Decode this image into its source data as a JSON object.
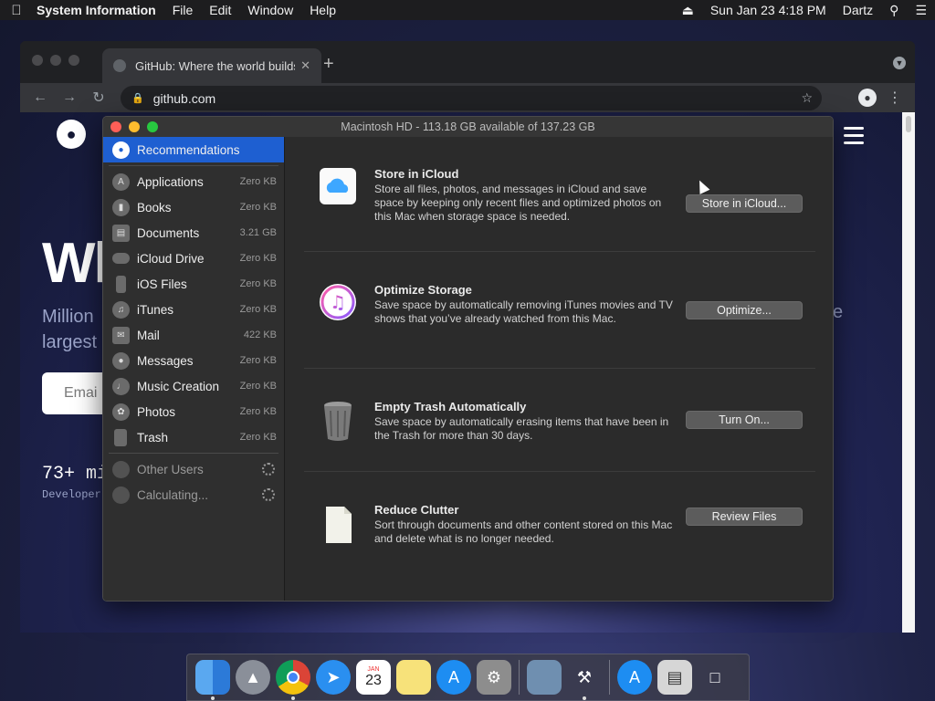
{
  "menubar": {
    "app_name": "System Information",
    "menus": [
      "File",
      "Edit",
      "Window",
      "Help"
    ],
    "clock": "Sun Jan 23  4:18 PM",
    "user": "Dartz"
  },
  "browser": {
    "tab_title": "GitHub: Where the world builds software",
    "url": "github.com",
    "page": {
      "hero": "Wh",
      "subtitle_line1": "Million",
      "subtitle_line2": "largest",
      "email_placeholder": "Emai",
      "stat_value": "73+ mi",
      "stat_label": "Developer",
      "edge_text_m": "m",
      "edge_text_e": "e"
    }
  },
  "sysinfo": {
    "title": "Macintosh HD - 113.18 GB available of 137.23 GB",
    "sidebar": {
      "selected": "Recommendations",
      "items": [
        {
          "label": "Applications",
          "size": "Zero KB"
        },
        {
          "label": "Books",
          "size": "Zero KB"
        },
        {
          "label": "Documents",
          "size": "3.21 GB"
        },
        {
          "label": "iCloud Drive",
          "size": "Zero KB"
        },
        {
          "label": "iOS Files",
          "size": "Zero KB"
        },
        {
          "label": "iTunes",
          "size": "Zero KB"
        },
        {
          "label": "Mail",
          "size": "422 KB"
        },
        {
          "label": "Messages",
          "size": "Zero KB"
        },
        {
          "label": "Music Creation",
          "size": "Zero KB"
        },
        {
          "label": "Photos",
          "size": "Zero KB"
        },
        {
          "label": "Trash",
          "size": "Zero KB"
        }
      ],
      "pending": [
        {
          "label": "Other Users"
        },
        {
          "label": "Calculating..."
        }
      ]
    },
    "recommendations": [
      {
        "title": "Store in iCloud",
        "desc": "Store all files, photos, and messages in iCloud and save space by keeping only recent files and optimized photos on this Mac when storage space is needed.",
        "button": "Store in iCloud...",
        "icon": "icloud-icon"
      },
      {
        "title": "Optimize Storage",
        "desc": "Save space by automatically removing iTunes movies and TV shows that you’ve already watched from this Mac.",
        "button": "Optimize...",
        "icon": "itunes-icon"
      },
      {
        "title": "Empty Trash Automatically",
        "desc": "Save space by automatically erasing items that have been in the Trash for more than 30 days.",
        "button": "Turn On...",
        "icon": "trash-icon"
      },
      {
        "title": "Reduce Clutter",
        "desc": "Sort through documents and other content stored on this Mac and delete what is no longer needed.",
        "button": "Review Files",
        "icon": "document-icon"
      }
    ]
  },
  "dock": {
    "calendar_month": "JAN",
    "calendar_day": "23"
  }
}
